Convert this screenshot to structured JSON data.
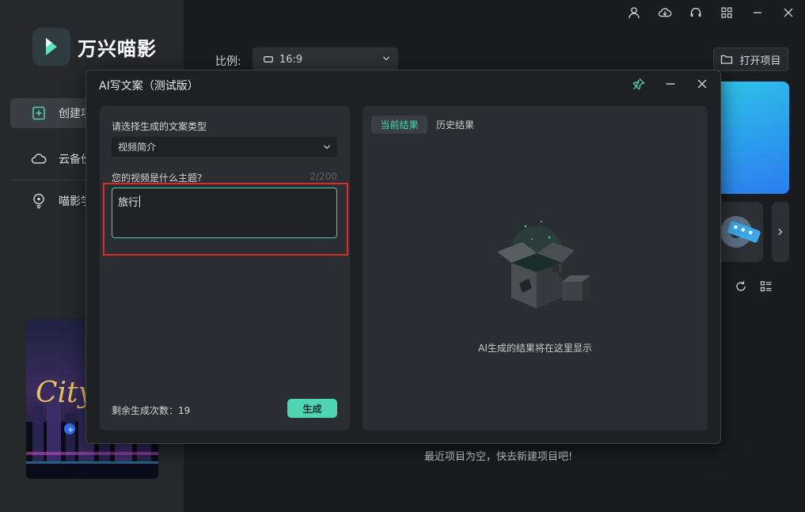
{
  "app": {
    "brand": "万兴喵影"
  },
  "sidebar": {
    "items": [
      {
        "label": "创建项",
        "icon": "add-file-icon"
      },
      {
        "label": "云备份",
        "icon": "cloud-icon"
      },
      {
        "label": "喵影学",
        "icon": "lightbulb-icon"
      }
    ],
    "promo": {
      "text": "City"
    }
  },
  "main": {
    "ratio_label": "比例:",
    "ratio_value": "16:9",
    "open_project": "打开项目",
    "empty_recent": "最近项目为空，快去新建项目吧!"
  },
  "dialog": {
    "title": "AI写文案（测试版）",
    "left": {
      "type_label": "请选择生成的文案类型",
      "type_value": "视频简介",
      "topic_label": "您的视频是什么主题?",
      "counter": "2/200",
      "topic_value": "旅行",
      "remaining_label": "剩余生成次数：19",
      "generate_button": "生成"
    },
    "right": {
      "tab_current": "当前结果",
      "tab_history": "历史结果",
      "empty_message": "AI生成的结果将在这里显示"
    }
  },
  "colors": {
    "accent": "#4fd4b4",
    "highlight": "#e02a2a",
    "hero": "#2b7cf0"
  }
}
